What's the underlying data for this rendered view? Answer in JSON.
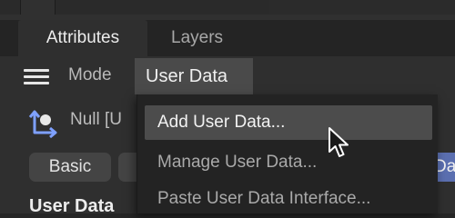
{
  "tabs": [
    {
      "label": "Attributes"
    },
    {
      "label": "Layers"
    }
  ],
  "modebar": {
    "menu_icon": "hamburger-menu-icon",
    "mode_label": "Mode",
    "user_data_label": "User Data"
  },
  "object": {
    "icon": "null-object-icon",
    "name": "Null [U"
  },
  "chips": {
    "basic_label": "Basic",
    "da_label": "Da"
  },
  "section": {
    "label": "User Data"
  },
  "dropdown": {
    "items": [
      {
        "label": "Add User Data..."
      },
      {
        "label": "Manage User Data..."
      },
      {
        "label": "Paste User Data Interface..."
      }
    ]
  },
  "colors": {
    "accent_chip": "#5b6fb0",
    "highlight_item": "#4c4c4c"
  }
}
